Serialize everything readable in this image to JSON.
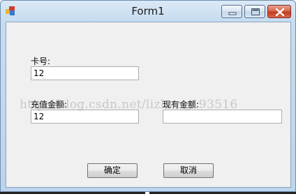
{
  "window": {
    "title": "Form1"
  },
  "form": {
    "card_label": "卡号:",
    "card_value": "12",
    "recharge_label": "充值金额:",
    "recharge_value": "12",
    "balance_label": "现有金额:",
    "balance_value": ""
  },
  "buttons": {
    "confirm": "确定",
    "cancel": "取消"
  },
  "watermark": {
    "text": "http://blog.csdn.net/lizhong193516"
  },
  "colors": {
    "titlebar": "#c6dcf0",
    "client": "#f0f0f0",
    "close_button": "#c2381d"
  },
  "icons": {
    "app": "app-icon",
    "minimize": "minimize-icon",
    "maximize": "maximize-icon",
    "close": "close-icon"
  }
}
